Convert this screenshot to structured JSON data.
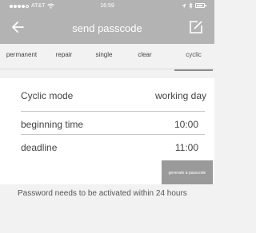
{
  "status_bar": {
    "carrier": "AT&T",
    "time": "16:59"
  },
  "nav": {
    "title": "send passcode",
    "back_icon": "back-arrow-icon",
    "edit_icon": "edit-share-icon"
  },
  "tabs": [
    {
      "label": "permanent",
      "active": false
    },
    {
      "label": "repair",
      "active": false
    },
    {
      "label": "single",
      "active": false
    },
    {
      "label": "clear",
      "active": false
    },
    {
      "label": "cyclic",
      "active": true
    }
  ],
  "form": {
    "cyclic_mode": {
      "label": "Cyclic mode",
      "value": "working day"
    },
    "beginning_time": {
      "label": "beginning time",
      "value": "10:00"
    },
    "deadline": {
      "label": "deadline",
      "value": "11:00"
    }
  },
  "generate_button": {
    "label": "generate a passcode"
  },
  "note": "Password needs to be activated within 24 hours",
  "colors": {
    "header_bg": "#b3b3b3",
    "button_bg": "#9a9a9a",
    "page_bg": "#f2f2f2"
  }
}
